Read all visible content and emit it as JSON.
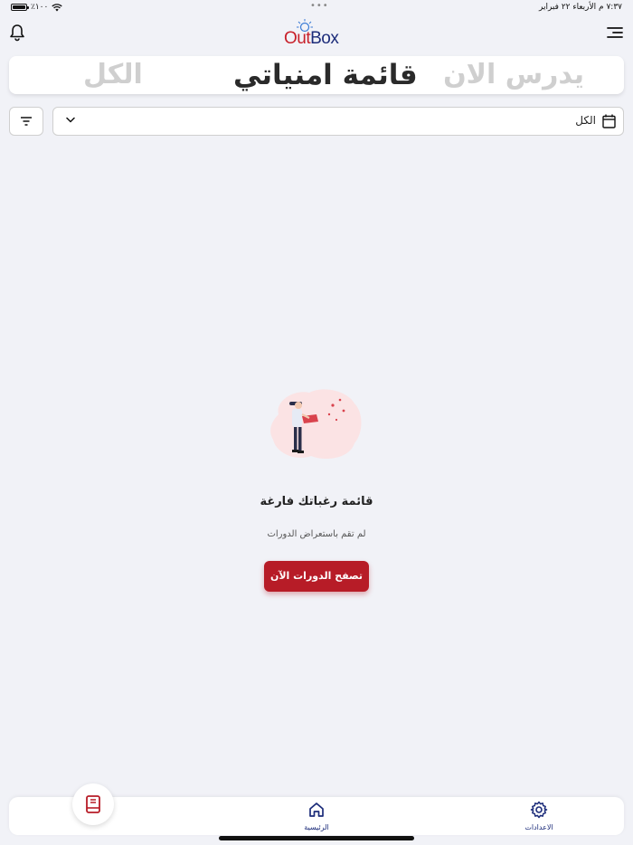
{
  "status_bar": {
    "time_date": "٧:٣٧ م   الأربعاء ٢٢ فبراير",
    "battery": "٪١٠٠"
  },
  "header": {
    "logo_out": "Out",
    "logo_box": "Box"
  },
  "tabs": [
    {
      "label": "يدرس الان"
    },
    {
      "label": "قائمة امنياتي"
    },
    {
      "label": "الكل"
    }
  ],
  "filter": {
    "selected": "الكل"
  },
  "empty_state": {
    "title": "قائمة رغباتك فارغة",
    "subtitle": "لم تقم باستعراض الدورات",
    "button_label": "تصفح الدورات الآن"
  },
  "bottom_nav": {
    "settings_label": "الاعدادات",
    "home_label": "الرئيسية"
  },
  "colors": {
    "accent": "#b71c27",
    "navy": "#1c2c7a",
    "background": "#f1f2f7"
  },
  "icons": [
    "menu-icon",
    "bell-icon",
    "calendar-icon",
    "chevron-down-icon",
    "filter-icon",
    "settings-icon",
    "home-icon",
    "book-icon"
  ]
}
